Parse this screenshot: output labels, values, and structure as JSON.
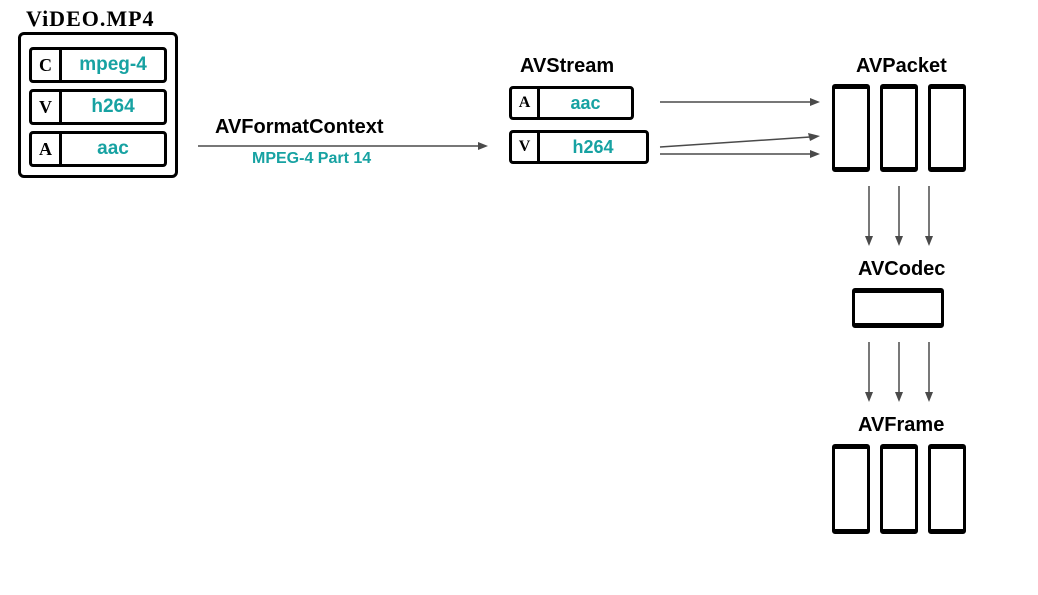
{
  "file": {
    "title": "ViDEO.MP4",
    "rows": [
      {
        "tag": "C",
        "codec": "mpeg-4"
      },
      {
        "tag": "V",
        "codec": "h264"
      },
      {
        "tag": "A",
        "codec": "aac"
      }
    ]
  },
  "format_context": {
    "title": "AVFormatContext",
    "subtitle": "MPEG-4 Part 14"
  },
  "avstream": {
    "title": "AVStream",
    "rows": [
      {
        "tag": "A",
        "codec": "aac"
      },
      {
        "tag": "V",
        "codec": "h264"
      }
    ]
  },
  "avpacket": {
    "title": "AVPacket"
  },
  "avcodec": {
    "title": "AVCodec"
  },
  "avframe": {
    "title": "AVFrame"
  }
}
